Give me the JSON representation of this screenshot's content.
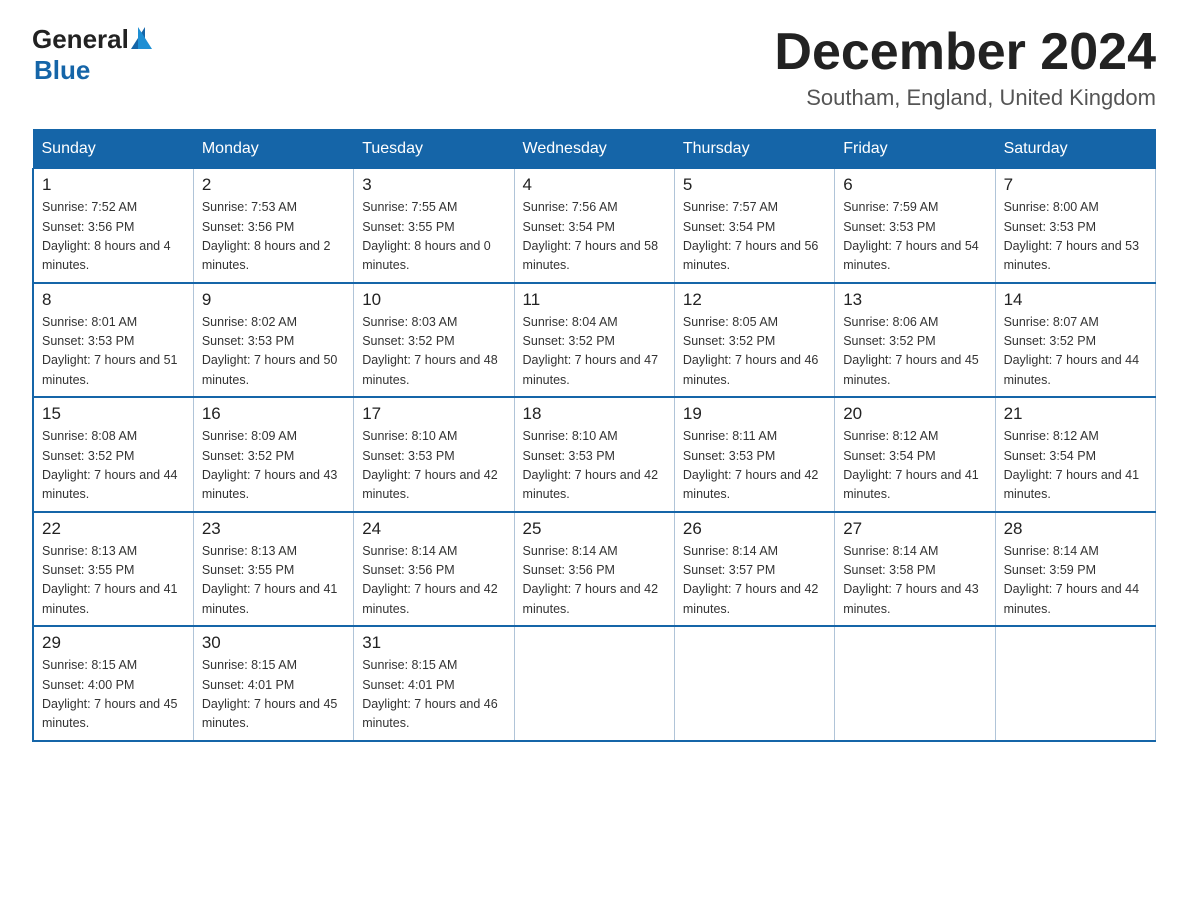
{
  "header": {
    "logo_general": "General",
    "logo_blue": "Blue",
    "month_title": "December 2024",
    "subtitle": "Southam, England, United Kingdom"
  },
  "days_of_week": [
    "Sunday",
    "Monday",
    "Tuesday",
    "Wednesday",
    "Thursday",
    "Friday",
    "Saturday"
  ],
  "weeks": [
    [
      {
        "num": "1",
        "sunrise": "7:52 AM",
        "sunset": "3:56 PM",
        "daylight": "8 hours and 4 minutes."
      },
      {
        "num": "2",
        "sunrise": "7:53 AM",
        "sunset": "3:56 PM",
        "daylight": "8 hours and 2 minutes."
      },
      {
        "num": "3",
        "sunrise": "7:55 AM",
        "sunset": "3:55 PM",
        "daylight": "8 hours and 0 minutes."
      },
      {
        "num": "4",
        "sunrise": "7:56 AM",
        "sunset": "3:54 PM",
        "daylight": "7 hours and 58 minutes."
      },
      {
        "num": "5",
        "sunrise": "7:57 AM",
        "sunset": "3:54 PM",
        "daylight": "7 hours and 56 minutes."
      },
      {
        "num": "6",
        "sunrise": "7:59 AM",
        "sunset": "3:53 PM",
        "daylight": "7 hours and 54 minutes."
      },
      {
        "num": "7",
        "sunrise": "8:00 AM",
        "sunset": "3:53 PM",
        "daylight": "7 hours and 53 minutes."
      }
    ],
    [
      {
        "num": "8",
        "sunrise": "8:01 AM",
        "sunset": "3:53 PM",
        "daylight": "7 hours and 51 minutes."
      },
      {
        "num": "9",
        "sunrise": "8:02 AM",
        "sunset": "3:53 PM",
        "daylight": "7 hours and 50 minutes."
      },
      {
        "num": "10",
        "sunrise": "8:03 AM",
        "sunset": "3:52 PM",
        "daylight": "7 hours and 48 minutes."
      },
      {
        "num": "11",
        "sunrise": "8:04 AM",
        "sunset": "3:52 PM",
        "daylight": "7 hours and 47 minutes."
      },
      {
        "num": "12",
        "sunrise": "8:05 AM",
        "sunset": "3:52 PM",
        "daylight": "7 hours and 46 minutes."
      },
      {
        "num": "13",
        "sunrise": "8:06 AM",
        "sunset": "3:52 PM",
        "daylight": "7 hours and 45 minutes."
      },
      {
        "num": "14",
        "sunrise": "8:07 AM",
        "sunset": "3:52 PM",
        "daylight": "7 hours and 44 minutes."
      }
    ],
    [
      {
        "num": "15",
        "sunrise": "8:08 AM",
        "sunset": "3:52 PM",
        "daylight": "7 hours and 44 minutes."
      },
      {
        "num": "16",
        "sunrise": "8:09 AM",
        "sunset": "3:52 PM",
        "daylight": "7 hours and 43 minutes."
      },
      {
        "num": "17",
        "sunrise": "8:10 AM",
        "sunset": "3:53 PM",
        "daylight": "7 hours and 42 minutes."
      },
      {
        "num": "18",
        "sunrise": "8:10 AM",
        "sunset": "3:53 PM",
        "daylight": "7 hours and 42 minutes."
      },
      {
        "num": "19",
        "sunrise": "8:11 AM",
        "sunset": "3:53 PM",
        "daylight": "7 hours and 42 minutes."
      },
      {
        "num": "20",
        "sunrise": "8:12 AM",
        "sunset": "3:54 PM",
        "daylight": "7 hours and 41 minutes."
      },
      {
        "num": "21",
        "sunrise": "8:12 AM",
        "sunset": "3:54 PM",
        "daylight": "7 hours and 41 minutes."
      }
    ],
    [
      {
        "num": "22",
        "sunrise": "8:13 AM",
        "sunset": "3:55 PM",
        "daylight": "7 hours and 41 minutes."
      },
      {
        "num": "23",
        "sunrise": "8:13 AM",
        "sunset": "3:55 PM",
        "daylight": "7 hours and 41 minutes."
      },
      {
        "num": "24",
        "sunrise": "8:14 AM",
        "sunset": "3:56 PM",
        "daylight": "7 hours and 42 minutes."
      },
      {
        "num": "25",
        "sunrise": "8:14 AM",
        "sunset": "3:56 PM",
        "daylight": "7 hours and 42 minutes."
      },
      {
        "num": "26",
        "sunrise": "8:14 AM",
        "sunset": "3:57 PM",
        "daylight": "7 hours and 42 minutes."
      },
      {
        "num": "27",
        "sunrise": "8:14 AM",
        "sunset": "3:58 PM",
        "daylight": "7 hours and 43 minutes."
      },
      {
        "num": "28",
        "sunrise": "8:14 AM",
        "sunset": "3:59 PM",
        "daylight": "7 hours and 44 minutes."
      }
    ],
    [
      {
        "num": "29",
        "sunrise": "8:15 AM",
        "sunset": "4:00 PM",
        "daylight": "7 hours and 45 minutes."
      },
      {
        "num": "30",
        "sunrise": "8:15 AM",
        "sunset": "4:01 PM",
        "daylight": "7 hours and 45 minutes."
      },
      {
        "num": "31",
        "sunrise": "8:15 AM",
        "sunset": "4:01 PM",
        "daylight": "7 hours and 46 minutes."
      },
      null,
      null,
      null,
      null
    ]
  ]
}
